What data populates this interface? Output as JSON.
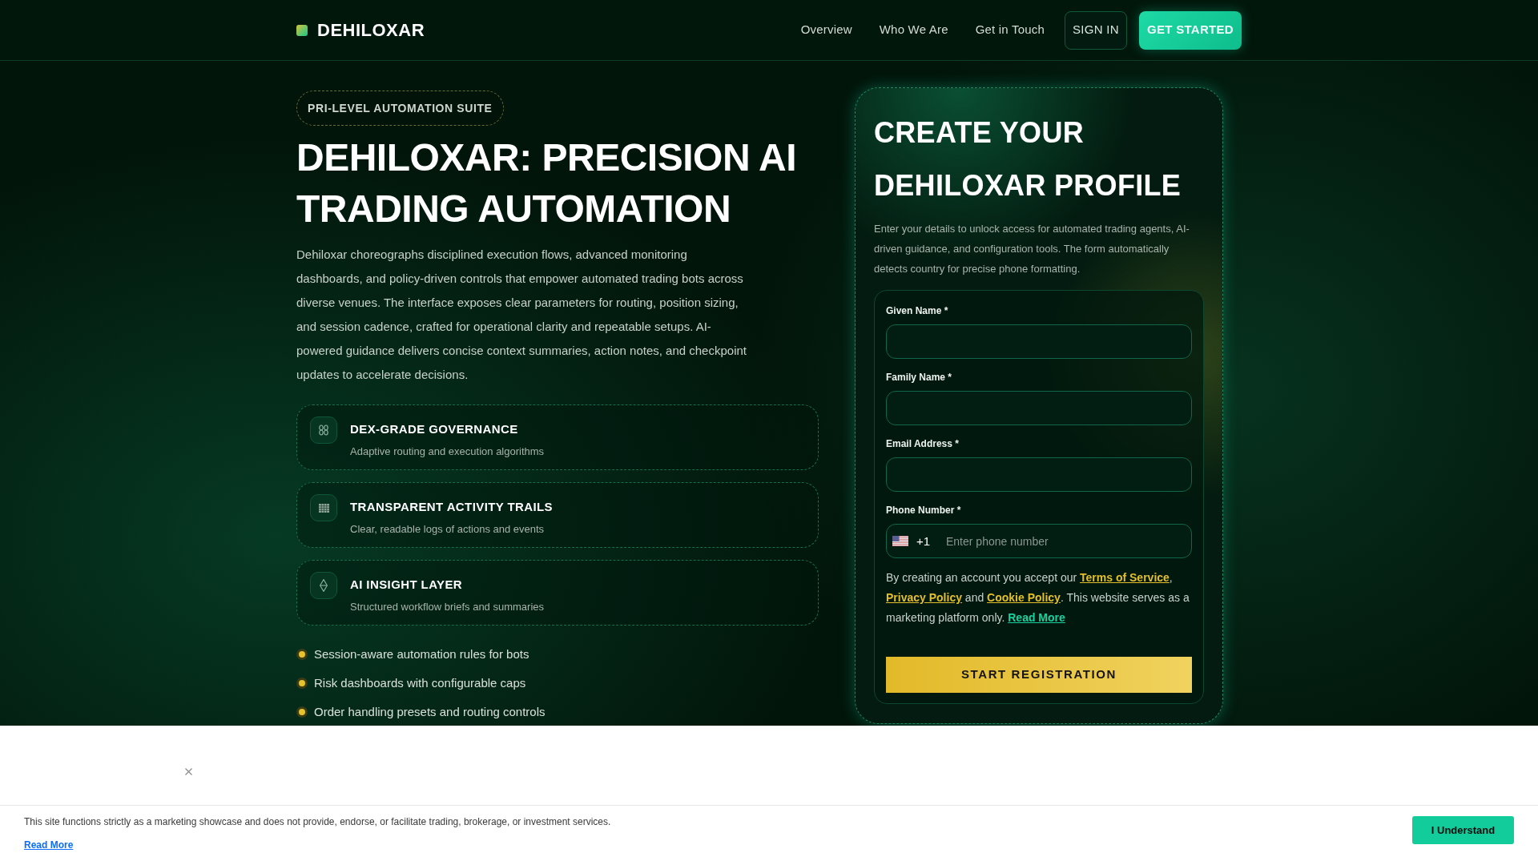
{
  "header": {
    "brand": "DEHILOXAR",
    "nav": [
      {
        "label": "Overview"
      },
      {
        "label": "Who We Are"
      },
      {
        "label": "Get in Touch"
      }
    ],
    "sign_in": "SIGN IN",
    "get_started": "GET STARTED"
  },
  "hero": {
    "badge": "PRI-LEVEL AUTOMATION SUITE",
    "title": "DEHILOXAR: PRECISION AI TRADING AUTOMATION",
    "description": "Dehiloxar choreographs disciplined execution flows, advanced monitoring dashboards, and policy-driven controls that empower automated trading bots across diverse venues. The interface exposes clear parameters for routing, position sizing, and session cadence, crafted for operational clarity and repeatable setups. AI-powered guidance delivers concise context summaries, action notes, and checkpoint updates to accelerate decisions.",
    "features": [
      {
        "title": "DEX-GRADE GOVERNANCE",
        "subtitle": "Adaptive routing and execution algorithms"
      },
      {
        "title": "TRANSPARENT ACTIVITY TRAILS",
        "subtitle": "Clear, readable logs of actions and events"
      },
      {
        "title": "AI INSIGHT LAYER",
        "subtitle": "Structured workflow briefs and summaries"
      }
    ],
    "bullets": [
      "Session-aware automation rules for bots",
      "Risk dashboards with configurable caps",
      "Order handling presets and routing controls"
    ]
  },
  "signup": {
    "title": "CREATE YOUR DEHILOXAR PROFILE",
    "description": "Enter your details to unlock access for automated trading agents, AI-driven guidance, and configuration tools. The form automatically detects country for precise phone formatting.",
    "fields": [
      {
        "kind": "text",
        "label": "Given Name *"
      },
      {
        "kind": "text",
        "label": "Family Name *"
      },
      {
        "kind": "text",
        "label": "Email Address *"
      },
      {
        "kind": "phone",
        "label": "Phone Number *",
        "dial_code": "+1",
        "placeholder": "Enter phone number"
      }
    ],
    "consent": [
      {
        "kind": "text",
        "text": "By creating an account you accept our "
      },
      {
        "kind": "legal_link",
        "text": "Terms of Service"
      },
      {
        "kind": "text",
        "text": ", "
      },
      {
        "kind": "legal_link",
        "text": "Privacy Policy"
      },
      {
        "kind": "text",
        "text": " and "
      },
      {
        "kind": "legal_link",
        "text": "Cookie Policy"
      },
      {
        "kind": "text",
        "text": ". This website serves as a marketing platform only. "
      },
      {
        "kind": "more_link",
        "text": "Read More"
      }
    ],
    "submit": "START REGISTRATION"
  },
  "cookie_banner": {
    "text": "This site functions strictly as a marketing showcase and does not provide, endorse, or facilitate trading, brokerage, or investment services.",
    "link": "Read More",
    "button": "I Understand"
  }
}
